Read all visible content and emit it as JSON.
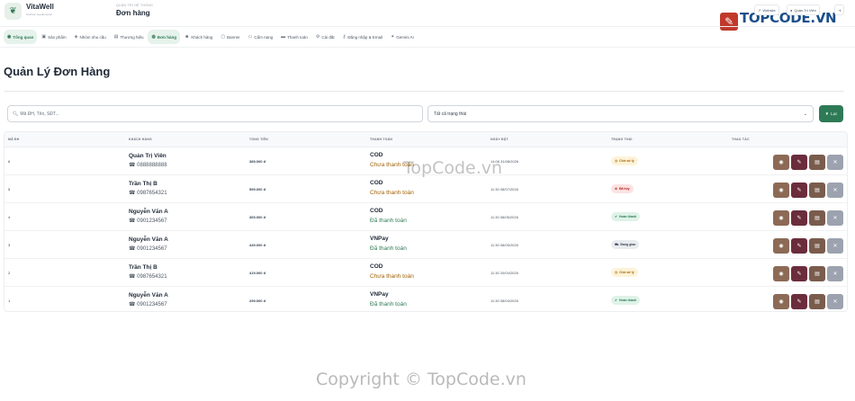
{
  "brand": {
    "name": "VitaWell",
    "tagline": "Nutrition supplements"
  },
  "header": {
    "section_label": "QUẢN TRỊ HỆ THỐNG",
    "page": "Đơn hàng",
    "buttons": [
      {
        "label": "Website",
        "icon": "external-link-icon"
      },
      {
        "label": "Quản Trị Viên",
        "icon": "user-icon"
      },
      {
        "label": "",
        "icon": "logout-icon"
      }
    ]
  },
  "overlay_logo": {
    "text": "TOPCODE.VN"
  },
  "nav": [
    {
      "label": "Tổng quan",
      "icon": "dashboard-icon",
      "active": true
    },
    {
      "label": "Sản phẩm",
      "icon": "box-icon"
    },
    {
      "label": "Nhóm nhu cầu",
      "icon": "tag-icon"
    },
    {
      "label": "Thương hiệu",
      "icon": "brand-icon"
    },
    {
      "label": "Đơn hàng",
      "icon": "cart-icon",
      "active": true
    },
    {
      "label": "Khách hàng",
      "icon": "users-icon"
    },
    {
      "label": "Banner",
      "icon": "image-icon"
    },
    {
      "label": "Cẩm nang",
      "icon": "book-icon"
    },
    {
      "label": "Thanh toán",
      "icon": "card-icon"
    },
    {
      "label": "Cài đặt",
      "icon": "settings-icon"
    },
    {
      "label": "Đăng nhập & Email",
      "icon": "key-icon"
    },
    {
      "label": "Gemini AI",
      "icon": "sparkle-icon"
    }
  ],
  "page_title": "Quản Lý Đơn Hàng",
  "filters": {
    "search_placeholder": "Mã ĐH, Tên, SĐT...",
    "status_value": "Tất cả trạng thái",
    "filter_button": "Lọc"
  },
  "table": {
    "headers": [
      "MÃ ĐH",
      "KHÁCH HÀNG",
      "TỔNG TIỀN",
      "THANH TOÁN",
      "NGÀY ĐẶT",
      "TRẠNG THÁI",
      "THAO TÁC"
    ],
    "rows": [
      {
        "id": "6",
        "name": "Quản Trị Viên",
        "phone": "0888888888",
        "total": "389.000 đ",
        "method": "COD",
        "pay_status": "Chưa thanh toán",
        "paid": false,
        "date": "14:06 31/08/2026",
        "status": "Chờ xử lý",
        "status_type": "pending"
      },
      {
        "id": "5",
        "name": "Trần Thị B",
        "phone": "0987654321",
        "total": "599.000 đ",
        "method": "COD",
        "pay_status": "Chưa thanh toán",
        "paid": false,
        "date": "11:30 08/07/2026",
        "status": "Đã hủy",
        "status_type": "cancel"
      },
      {
        "id": "4",
        "name": "Nguyễn Văn A",
        "phone": "0901234567",
        "total": "365.000 đ",
        "method": "COD",
        "pay_status": "Đã thanh toán",
        "paid": true,
        "date": "11:30 08/06/2026",
        "status": "Hoàn thành",
        "status_type": "done"
      },
      {
        "id": "3",
        "name": "Nguyễn Văn A",
        "phone": "0901234567",
        "total": "449.000 đ",
        "method": "VNPay",
        "pay_status": "Đã thanh toán",
        "paid": true,
        "date": "11:30 08/05/2026",
        "status": "Đang giao",
        "status_type": "ship"
      },
      {
        "id": "2",
        "name": "Trần Thị B",
        "phone": "0987654321",
        "total": "419.000 đ",
        "method": "COD",
        "pay_status": "Chưa thanh toán",
        "paid": false,
        "date": "11:30 20/04/2026",
        "status": "Chờ xử lý",
        "status_type": "pending"
      },
      {
        "id": "1",
        "name": "Nguyễn Văn A",
        "phone": "0901234567",
        "total": "299.000 đ",
        "method": "VNPay",
        "pay_status": "Đã thanh toán",
        "paid": true,
        "date": "11:30 08/04/2026",
        "status": "Hoàn thành",
        "status_type": "done"
      }
    ],
    "actions": [
      {
        "icon": "eye-icon",
        "color": "#8c6a56"
      },
      {
        "icon": "edit-icon",
        "color": "#6b2d3c"
      },
      {
        "icon": "print-icon",
        "color": "#7a5c4d"
      },
      {
        "icon": "delete-icon",
        "color": "#9ca3af"
      }
    ]
  },
  "watermark": "TopCode.vn",
  "copyright": "Copyright © TopCode.vn"
}
